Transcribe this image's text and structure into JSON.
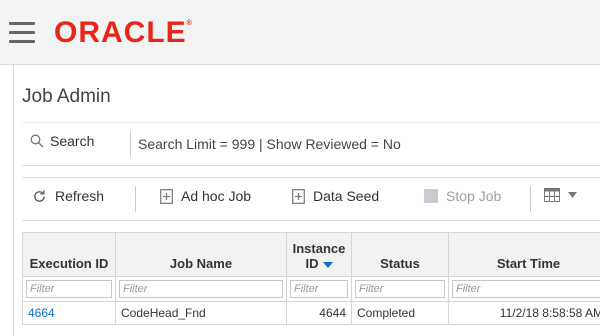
{
  "header": {
    "brand": "ORACLE",
    "brand_mark": "®"
  },
  "page": {
    "title": "Job Admin"
  },
  "search": {
    "button_label": "Search",
    "criteria": "Search Limit = 999 | Show Reviewed = No"
  },
  "toolbar": {
    "refresh_label": "Refresh",
    "adhoc_label": "Ad hoc Job",
    "dataseed_label": "Data Seed",
    "stopjob_label": "Stop Job"
  },
  "table": {
    "columns": {
      "execution_id": "Execution ID",
      "job_name": "Job Name",
      "instance_id_line1": "Instance",
      "instance_id_line2": "ID",
      "status": "Status",
      "start_time": "Start Time"
    },
    "filter_placeholder": "Filter",
    "rows": [
      {
        "execution_id": "4664",
        "job_name": "CodeHead_Fnd",
        "instance_id": "4644",
        "status": "Completed",
        "start_time": "11/2/18 8:58:58 AM"
      }
    ]
  },
  "colors": {
    "brand_red": "#e8261a",
    "link_blue": "#0572ce"
  }
}
